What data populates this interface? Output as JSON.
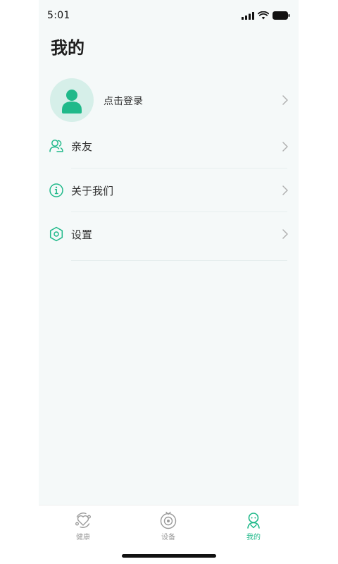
{
  "status_bar": {
    "time": "5:01"
  },
  "page": {
    "title": "我的"
  },
  "profile": {
    "login_label": "点击登录"
  },
  "menu": {
    "items": [
      {
        "label": "亲友",
        "icon": "friends-icon"
      },
      {
        "label": "关于我们",
        "icon": "info-icon"
      },
      {
        "label": "设置",
        "icon": "settings-hexagon-icon"
      }
    ]
  },
  "tab_bar": {
    "tabs": [
      {
        "label": "健康",
        "icon": "health-heart-icon",
        "active": false
      },
      {
        "label": "设备",
        "icon": "device-icon",
        "active": false
      },
      {
        "label": "我的",
        "icon": "profile-icon",
        "active": true
      }
    ]
  },
  "colors": {
    "accent": "#20b98a",
    "background": "#f5f9f9",
    "avatar_bg": "#d6efe9",
    "inactive_tab": "#9a9a9a"
  }
}
